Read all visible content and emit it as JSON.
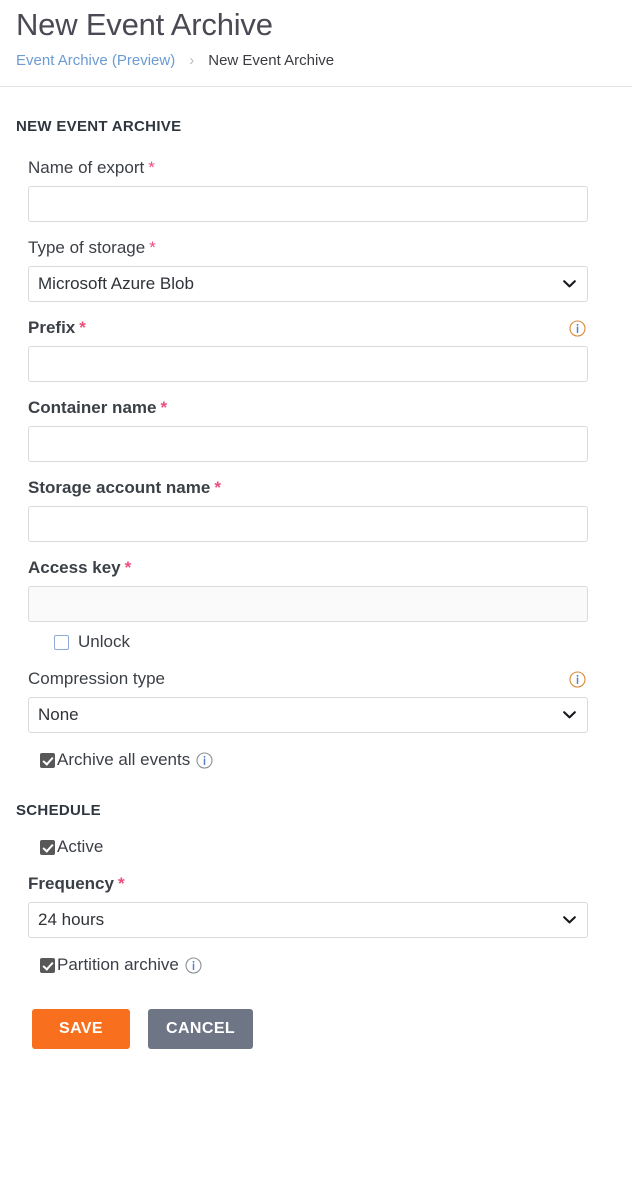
{
  "header": {
    "title": "New Event Archive",
    "breadcrumb": {
      "parent": "Event Archive (Preview)",
      "separator": "›",
      "current": "New Event Archive"
    }
  },
  "form": {
    "section_title": "NEW EVENT ARCHIVE",
    "required_mark": "*",
    "fields": {
      "name_of_export": {
        "label": "Name of export",
        "value": "",
        "placeholder": ""
      },
      "type_of_storage": {
        "label": "Type of storage",
        "value": "Microsoft Azure Blob",
        "options": [
          "Microsoft Azure Blob"
        ]
      },
      "prefix": {
        "label": "Prefix",
        "value": "",
        "placeholder": "",
        "info_icon": "info-circle-icon"
      },
      "container_name": {
        "label": "Container name",
        "value": "",
        "placeholder": ""
      },
      "storage_account_name": {
        "label": "Storage account name",
        "value": "",
        "placeholder": ""
      },
      "access_key": {
        "label": "Access key",
        "value": "",
        "placeholder": "",
        "unlock_label": "Unlock",
        "unlock_checked": false
      },
      "compression_type": {
        "label": "Compression type",
        "value": "None",
        "options": [
          "None"
        ],
        "info_icon": "info-circle-icon"
      },
      "archive_all_events": {
        "label": "Archive all events",
        "checked": true,
        "info_icon": "info-circle-icon"
      }
    }
  },
  "schedule": {
    "section_title": "SCHEDULE",
    "active": {
      "label": "Active",
      "checked": true
    },
    "frequency": {
      "label": "Frequency",
      "value": "24 hours",
      "options": [
        "24 hours"
      ]
    },
    "partition_archive": {
      "label": "Partition archive",
      "checked": true,
      "info_icon": "info-circle-icon"
    }
  },
  "actions": {
    "save_label": "SAVE",
    "cancel_label": "CANCEL"
  },
  "colors": {
    "accent_save": "#f8701d",
    "cancel": "#6e7585",
    "link": "#6b9bd2",
    "required": "#ed4c7c",
    "checkbox_checked": "#585858",
    "checkbox_empty_border": "#8fa9dd",
    "info_icon": "#d98a3a"
  }
}
